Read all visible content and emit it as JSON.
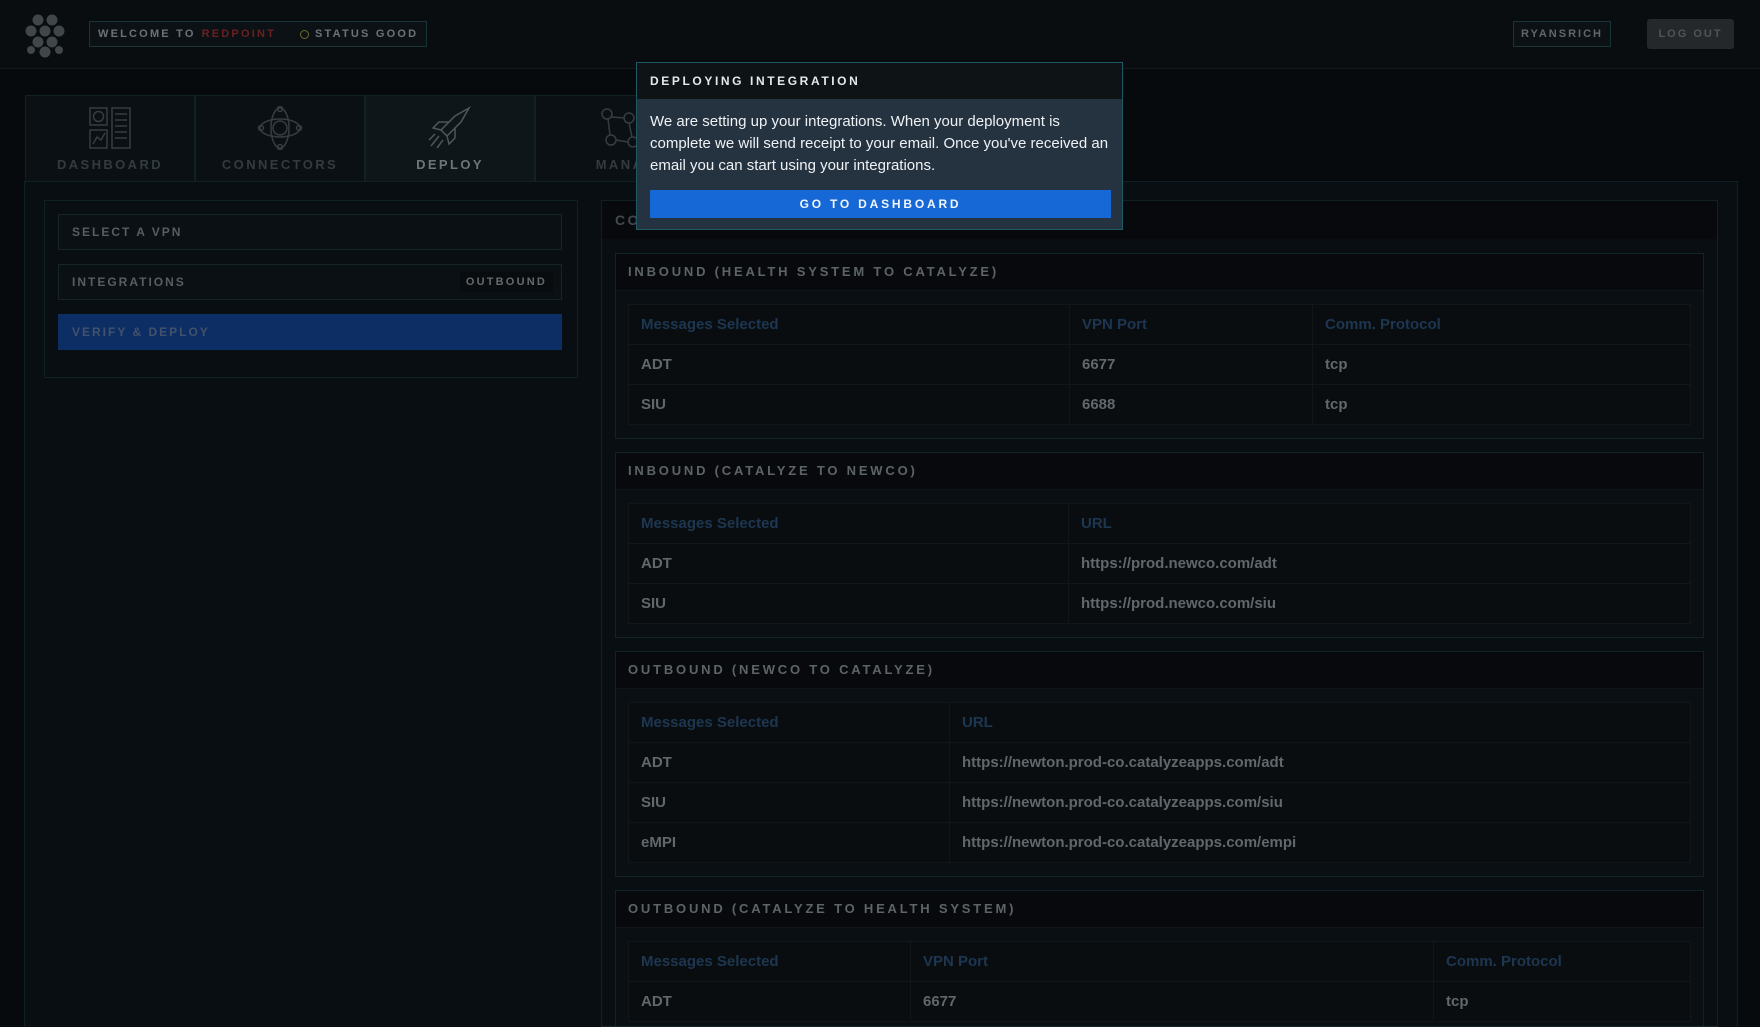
{
  "header": {
    "welcome_prefix": "WELCOME TO",
    "brand": "REDPOINT",
    "status": "STATUS GOOD",
    "username": "RYANSRICH",
    "logout_label": "LOG OUT"
  },
  "tabs": [
    {
      "label": "DASHBOARD",
      "icon": "dashboard-icon"
    },
    {
      "label": "CONNECTORS",
      "icon": "connectors-icon"
    },
    {
      "label": "DEPLOY",
      "icon": "rocket-icon"
    },
    {
      "label": "MANA",
      "icon": "manage-icon"
    }
  ],
  "steps": [
    {
      "label": "SELECT A VPN"
    },
    {
      "label": "INTEGRATIONS",
      "tag": "OUTBOUND"
    },
    {
      "label": "VERIFY & DEPLOY"
    }
  ],
  "panel_header": "CO",
  "sections": [
    {
      "title": "INBOUND (HEALTH SYSTEM TO CATALYZE)",
      "columns": [
        "Messages Selected",
        "VPN Port",
        "Comm. Protocol"
      ],
      "rows": [
        [
          "ADT",
          "6677",
          "tcp"
        ],
        [
          "SIU",
          "6688",
          "tcp"
        ]
      ]
    },
    {
      "title": "INBOUND (CATALYZE TO NEWCO)",
      "columns": [
        "Messages Selected",
        "URL"
      ],
      "rows": [
        [
          "ADT",
          "https://prod.newco.com/adt"
        ],
        [
          "SIU",
          "https://prod.newco.com/siu"
        ]
      ]
    },
    {
      "title": "OUTBOUND (NEWCO TO CATALYZE)",
      "columns": [
        "Messages Selected",
        "URL"
      ],
      "rows": [
        [
          "ADT",
          "https://newton.prod-co.catalyzeapps.com/adt"
        ],
        [
          "SIU",
          "https://newton.prod-co.catalyzeapps.com/siu"
        ],
        [
          "eMPI",
          "https://newton.prod-co.catalyzeapps.com/empi"
        ]
      ]
    },
    {
      "title": "OUTBOUND (CATALYZE TO HEALTH SYSTEM)",
      "columns": [
        "Messages Selected",
        "VPN Port",
        "Comm. Protocol"
      ],
      "rows": [
        [
          "ADT",
          "6677",
          "tcp"
        ]
      ]
    }
  ],
  "modal": {
    "title": "DEPLOYING INTEGRATION",
    "body": "We are setting up your integrations. When your deployment is complete we will send receipt to your email. Once you've received an email you can start using your integrations.",
    "button": "GO TO DASHBOARD"
  },
  "colors": {
    "accent": "#1668d6",
    "brand": "#7a2424",
    "active_step": "#0f3572"
  }
}
